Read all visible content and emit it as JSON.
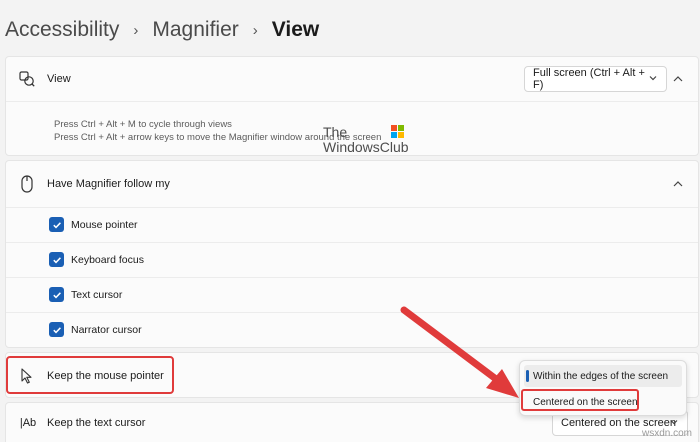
{
  "breadcrumb": {
    "items": [
      "Accessibility",
      "Magnifier",
      "View"
    ]
  },
  "view_section": {
    "label": "View",
    "select_value": "Full screen (Ctrl + Alt + F)",
    "hints": [
      "Press Ctrl + Alt + M to cycle through views",
      "Press Ctrl + Alt + arrow keys to move the Magnifier window around the screen"
    ]
  },
  "follow_section": {
    "label": "Have Magnifier follow my",
    "options": [
      {
        "label": "Mouse pointer",
        "checked": true
      },
      {
        "label": "Keyboard focus",
        "checked": true
      },
      {
        "label": "Text cursor",
        "checked": true
      },
      {
        "label": "Narrator cursor",
        "checked": true
      }
    ]
  },
  "mouse_pointer_row": {
    "label": "Keep the mouse pointer"
  },
  "mouse_pointer_dropdown": {
    "options": [
      "Within the edges of the screen",
      "Centered on the screen"
    ],
    "selected": "Within the edges of the screen"
  },
  "text_cursor_row": {
    "label": "Keep the text cursor",
    "select_value": "Centered on the screen"
  },
  "watermark": {
    "line1": "The",
    "line2": "WindowsClub"
  },
  "site_mark": "wsxdn.com",
  "colors": {
    "accent": "#1a5fb4",
    "annotation": "#e03b3b"
  }
}
